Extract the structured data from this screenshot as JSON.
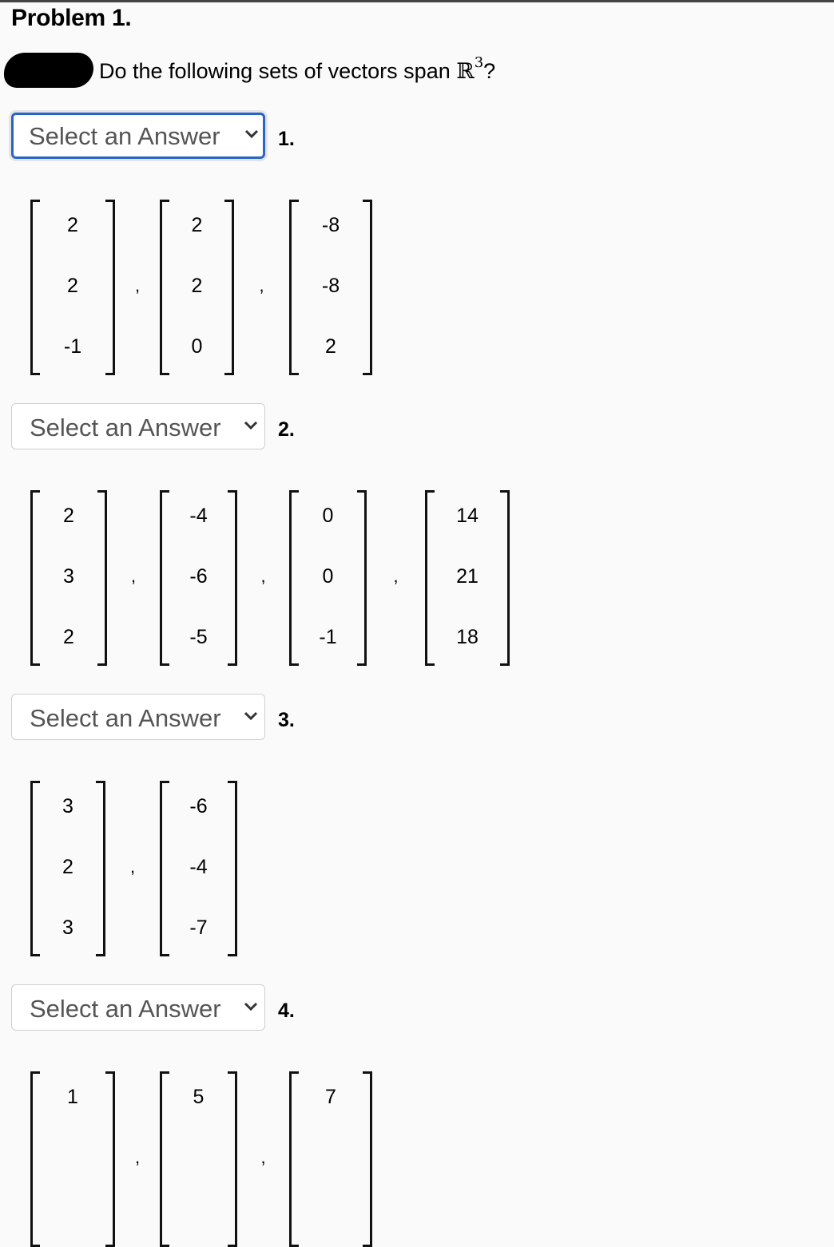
{
  "problem": {
    "title": "Problem 1.",
    "prompt": "Do the following sets of vectors span ",
    "prompt_symbol": "ℝ",
    "prompt_exponent": "3",
    "prompt_end": "?"
  },
  "select_placeholder": "Select an Answer",
  "parts": [
    {
      "number": "1.",
      "selected": "Select an Answer",
      "vectors": [
        [
          "2",
          "2",
          "-1"
        ],
        [
          "2",
          "2",
          "0"
        ],
        [
          "-8",
          "-8",
          "2"
        ]
      ]
    },
    {
      "number": "2.",
      "selected": "Select an Answer",
      "vectors": [
        [
          "2",
          "3",
          "2"
        ],
        [
          "-4",
          "-6",
          "-5"
        ],
        [
          "0",
          "0",
          "-1"
        ],
        [
          "14",
          "21",
          "18"
        ]
      ]
    },
    {
      "number": "3.",
      "selected": "Select an Answer",
      "vectors": [
        [
          "3",
          "2",
          "3"
        ],
        [
          "-6",
          "-4",
          "-7"
        ]
      ]
    },
    {
      "number": "4.",
      "selected": "Select an Answer",
      "vectors": [
        [
          "1"
        ],
        [
          "5"
        ],
        [
          "7"
        ]
      ]
    }
  ],
  "colors": {
    "focus_border": "#2a64c6",
    "select_text": "#555555",
    "background": "#fafafa"
  }
}
